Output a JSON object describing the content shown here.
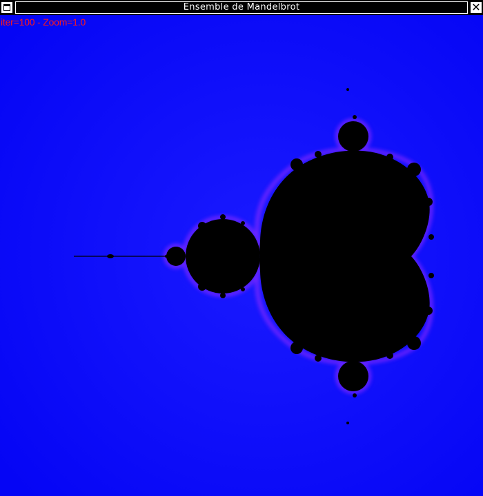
{
  "window": {
    "title": "Ensemble de Mandelbrot",
    "menu_icon": "window-menu-icon",
    "close_icon": "close-icon",
    "close_glyph": "✕"
  },
  "status": {
    "text": "iter=100 - Zoom=1.0",
    "iter": 100,
    "zoom": 1.0
  },
  "colors": {
    "background": "#0a0aff",
    "set": "#000000",
    "fringe": "#c040ff",
    "status_text": "#ff1a1a",
    "titlebar": "#000000",
    "title_text": "#ffffff"
  }
}
